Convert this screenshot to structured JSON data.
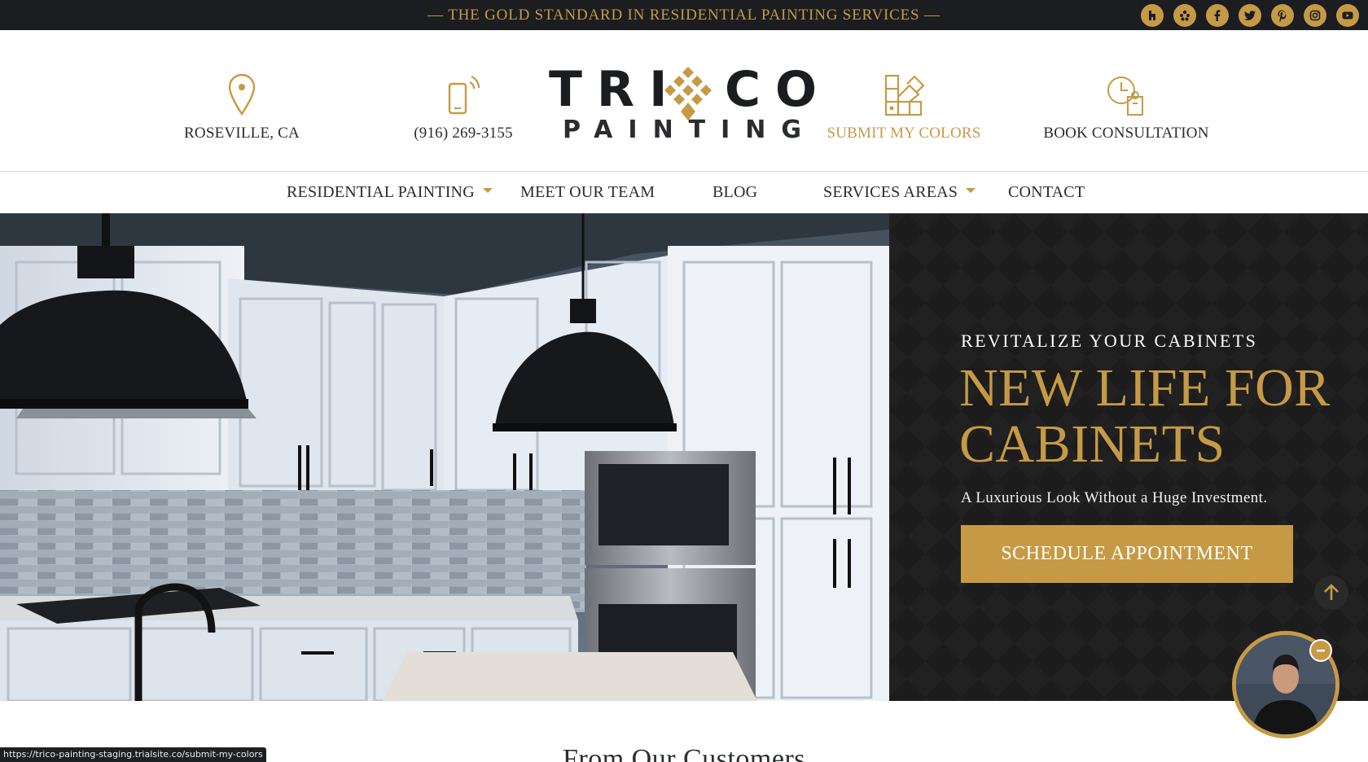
{
  "topbar": {
    "tagline": "— THE GOLD STANDARD IN RESIDENTIAL PAINTING SERVICES —",
    "socials": [
      "houzz-icon",
      "yelp-icon",
      "facebook-icon",
      "twitter-icon",
      "pinterest-icon",
      "instagram-icon",
      "youtube-icon"
    ]
  },
  "header": {
    "location": "ROSEVILLE, CA",
    "phone": "(916) 269-3155",
    "submit_colors": "SUBMIT MY COLORS",
    "book": "BOOK CONSULTATION",
    "logo_left": "TRI",
    "logo_right": "CO",
    "logo_sub": "PAINTING"
  },
  "nav": {
    "items": [
      "RESIDENTIAL PAINTING",
      "MEET OUR TEAM",
      "BLOG",
      "SERVICES AREAS",
      "CONTACT"
    ]
  },
  "hero": {
    "eyebrow": "REVITALIZE YOUR CABINETS",
    "headline_1": "NEW LIFE FOR",
    "headline_2": "CABINETS",
    "subline": "A Luxurious Look Without a Huge Investment.",
    "cta": "SCHEDULE APPOINTMENT"
  },
  "section": {
    "title": "From Our Customers"
  },
  "status": {
    "url": "https://trico-painting-staging.trialsite.co/submit-my-colors"
  },
  "colors": {
    "gold": "#c69a45",
    "dark": "#1b1d21"
  }
}
